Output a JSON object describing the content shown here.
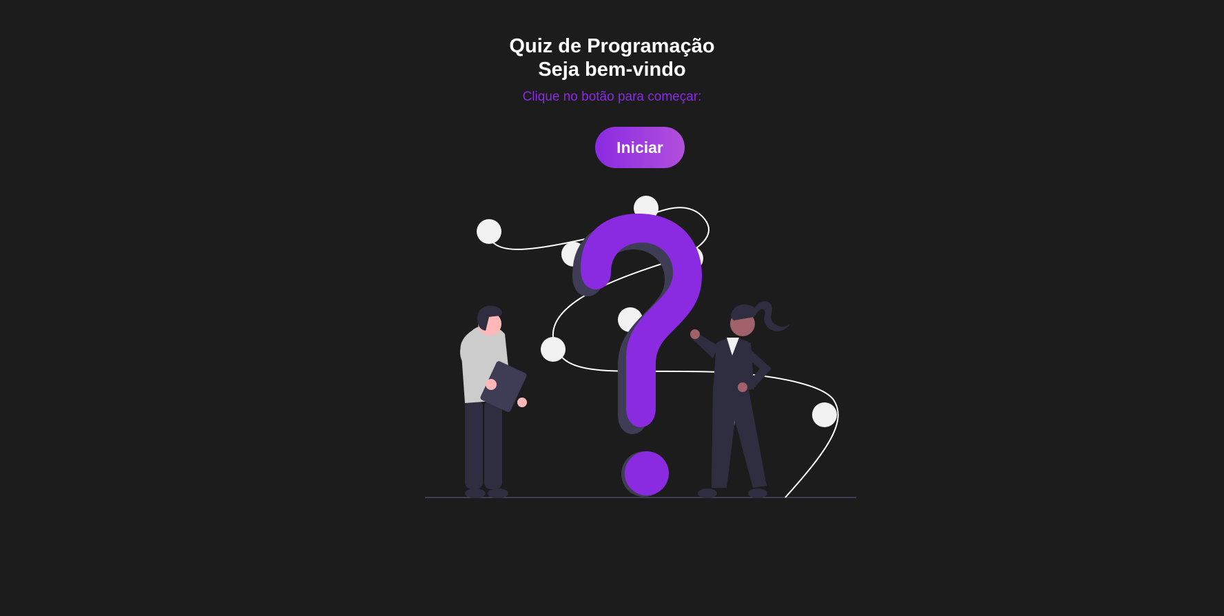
{
  "header": {
    "title_line1": "Quiz de Programação",
    "title_line2": "Seja bem-vindo",
    "instruction": "Clique no botão para começar:"
  },
  "actions": {
    "start_label": "Iniciar"
  },
  "illustration": {
    "icon": "question-mark-people-icon"
  },
  "colors": {
    "background": "#1c1c1c",
    "accent": "#8a2be2",
    "accent_gradient_end": "#b34fdc",
    "text": "#ffffff",
    "figure_dark": "#2f2e41",
    "dots": "#f2f2f2"
  }
}
